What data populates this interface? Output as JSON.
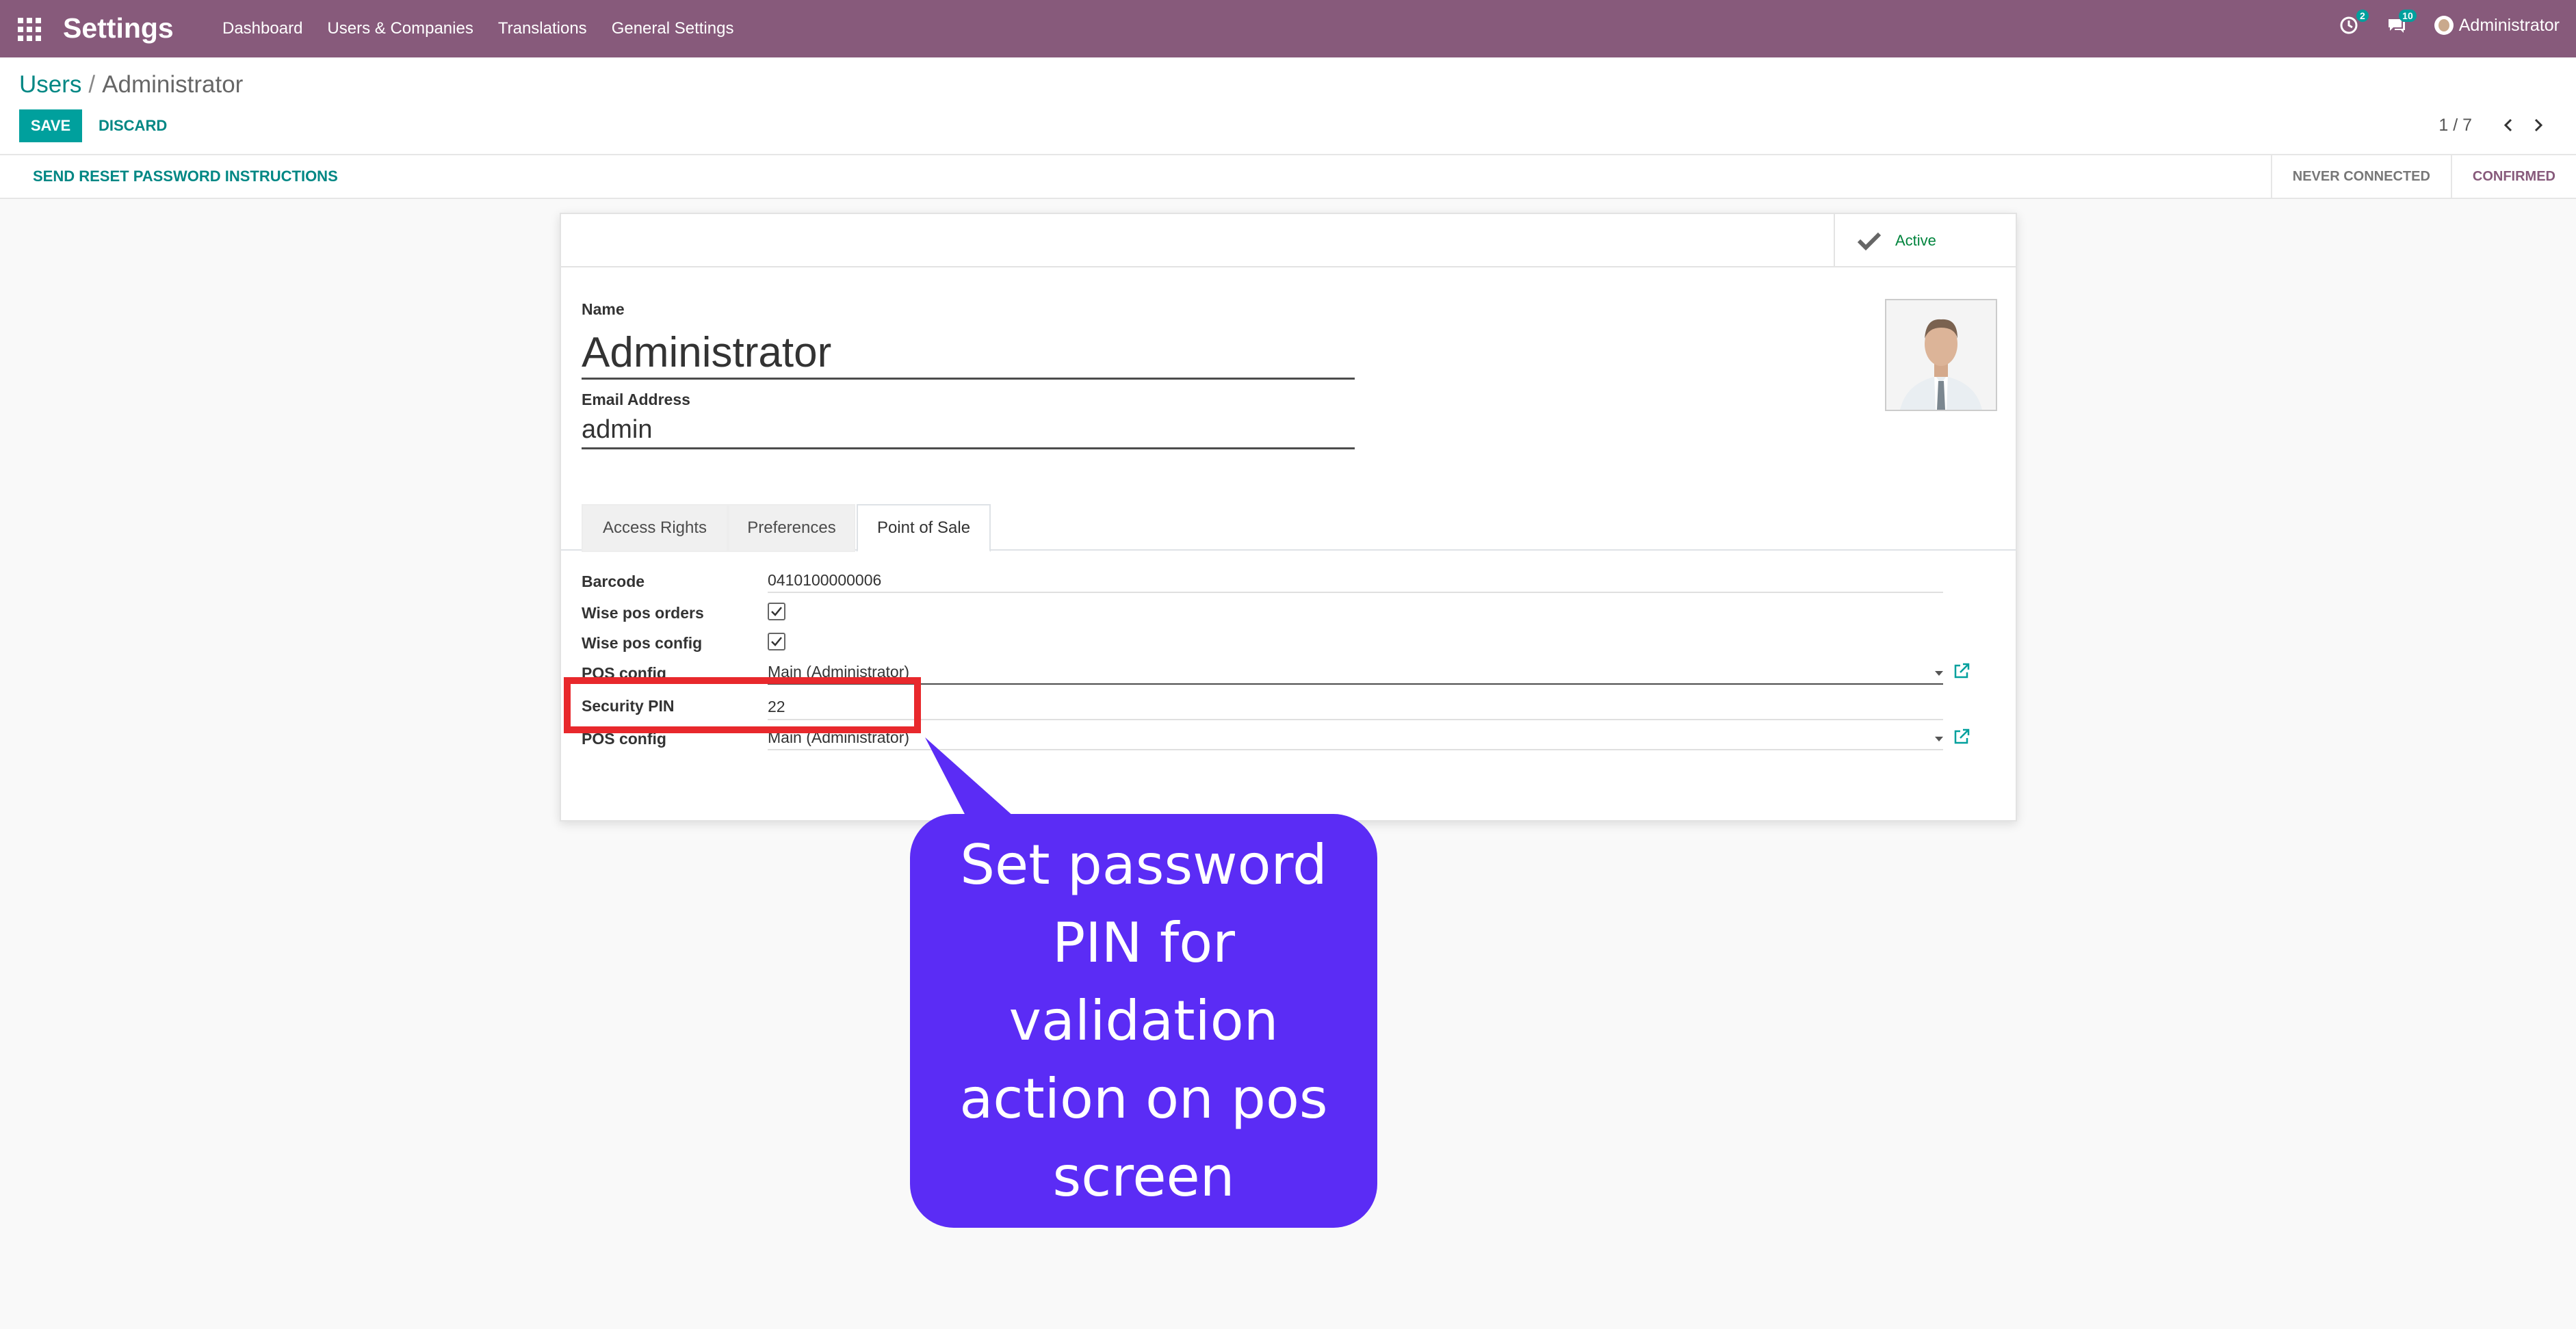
{
  "navbar": {
    "app_name": "Settings",
    "menu": [
      "Dashboard",
      "Users & Companies",
      "Translations",
      "General Settings"
    ],
    "activity_count": "2",
    "message_count": "10",
    "user_name": "Administrator"
  },
  "breadcrumb": {
    "parent": "Users",
    "separator": "/",
    "current": "Administrator"
  },
  "actions": {
    "save": "SAVE",
    "discard": "DISCARD"
  },
  "pager": {
    "value": "1 / 7"
  },
  "statusbar": {
    "reset_password": "SEND RESET PASSWORD INSTRUCTIONS",
    "stages": [
      "NEVER CONNECTED",
      "CONFIRMED"
    ],
    "current_stage": "CONFIRMED"
  },
  "form": {
    "active_label": "Active",
    "name_label": "Name",
    "name_value": "Administrator",
    "email_label": "Email Address",
    "email_value": "admin",
    "tabs": [
      "Access Rights",
      "Preferences",
      "Point of Sale"
    ],
    "active_tab": "Point of Sale",
    "pos_fields": {
      "barcode_label": "Barcode",
      "barcode_value": "0410100000006",
      "wise_orders_label": "Wise pos orders",
      "wise_orders_checked": true,
      "wise_config_label": "Wise pos config",
      "wise_config_checked": true,
      "pos_config_label": "POS config",
      "pos_config_value": "Main (Administrator)",
      "security_pin_label": "Security PIN",
      "security_pin_value": "22",
      "pos_config2_label": "POS config",
      "pos_config2_value": "Main (Administrator)"
    }
  },
  "annotation": {
    "callout_text": "Set password PIN for validation action on pos screen",
    "highlight_color": "#e8282c",
    "callout_color": "#5b2cf5"
  },
  "colors": {
    "navbar": "#875a7b",
    "primary": "#00a09d",
    "link": "#008784",
    "active_green": "#00843d"
  },
  "icons": [
    "apps-icon",
    "activity-icon",
    "messages-icon",
    "chevron-left-icon",
    "chevron-right-icon",
    "check-icon",
    "external-link-icon"
  ]
}
